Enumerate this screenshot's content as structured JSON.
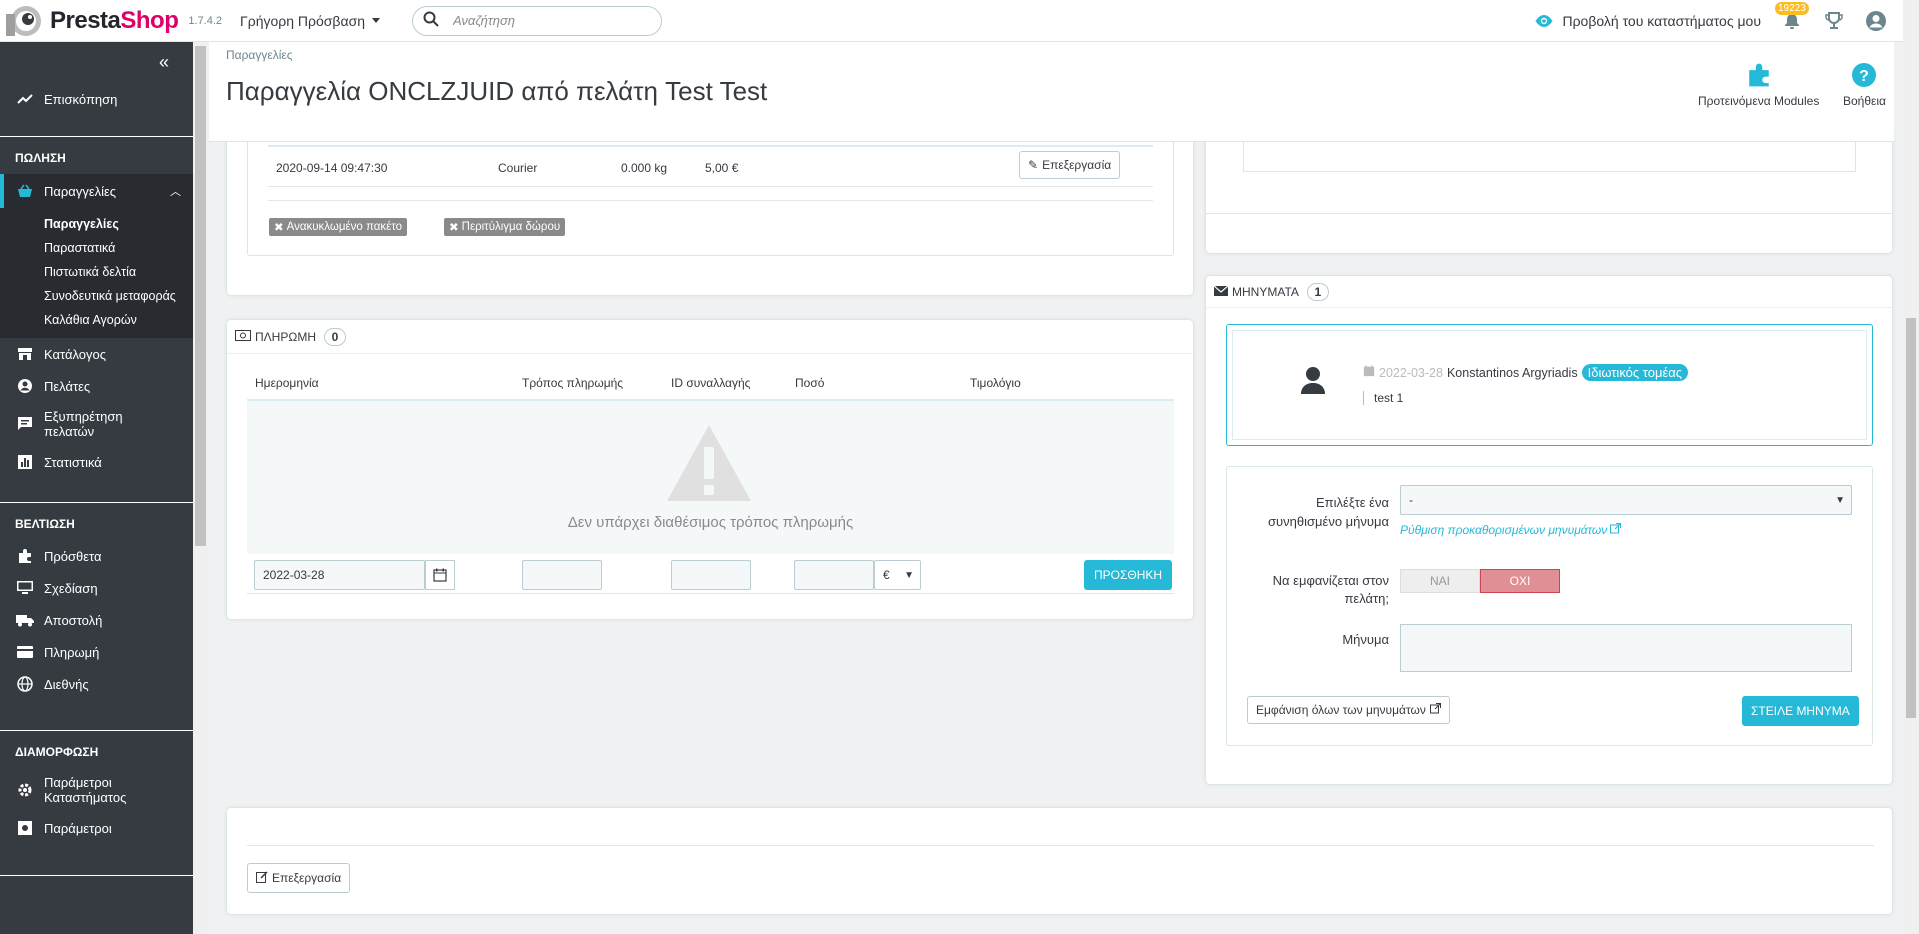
{
  "header": {
    "logo_brand_a": "Presta",
    "logo_brand_b": "Shop",
    "version": "1.7.4.2",
    "quick_access": "Γρήγορη Πρόσβαση",
    "search_placeholder": "Αναζήτηση",
    "view_store": "Προβολή του καταστήματος μου",
    "notifications_count": "19223"
  },
  "sidebar": {
    "overview": "Επισκόπηση",
    "section_sell": "ΠΩΛΗΣΗ",
    "orders": "Παραγγελίες",
    "orders_sub": [
      "Παραγγελίες",
      "Παραστατικά",
      "Πιστωτικά δελτία",
      "Συνοδευτικά μεταφοράς",
      "Καλάθια Αγορών"
    ],
    "catalog": "Κατάλογος",
    "customers": "Πελάτες",
    "customer_service_1": "Εξυπηρέτηση",
    "customer_service_2": "πελατών",
    "stats": "Στατιστικά",
    "section_improve": "ΒΕΛΤΙΩΣΗ",
    "modules": "Πρόσθετα",
    "design": "Σχεδίαση",
    "shipping": "Αποστολή",
    "payment": "Πληρωμή",
    "international": "Διεθνής",
    "section_configure": "ΔΙΑΜΟΡΦΩΣΗ",
    "shop_params_1": "Παράμετροι",
    "shop_params_2": "Καταστήματος",
    "advanced_params": "Παράμετροι"
  },
  "page": {
    "breadcrumb": "Παραγγελίες",
    "title": "Παραγγελία ONCLZJUID από πελάτη Test Test",
    "btn_modules": "Προτεινόμενα Modules",
    "btn_help": "Βοήθεια"
  },
  "shipping": {
    "row": {
      "date": "2020-09-14 09:47:30",
      "carrier": "Courier",
      "weight": "0.000 kg",
      "cost": "5,00 €",
      "edit": "Επεξεργασία"
    },
    "tag_recycled": "Ανακυκλωμένο πακέτο",
    "tag_gift": "Περιτύλιγμα δώρου"
  },
  "payment": {
    "heading": "ΠΛΗΡΩΜΗ",
    "count": "0",
    "cols": [
      "Ημερομηνία",
      "Τρόπος πληρωμής",
      "ID συναλλαγής",
      "Ποσό",
      "Τιμολόγιο"
    ],
    "empty": "Δεν υπάρχει διαθέσιμος τρόπος πληρωμής",
    "date_value": "2022-03-28",
    "currency": "€",
    "add": "ΠΡΟΣΘΗΚΗ"
  },
  "messages": {
    "heading": "ΜΗΝΥΜΑΤΑ",
    "count": "1",
    "msg_date": "2022-03-28",
    "msg_author": "Konstantinos Argyriadis",
    "msg_type": "Ιδιωτικός τομέας",
    "msg_text": "test 1",
    "label_predefined_1": "Επιλέξτε ένα",
    "label_predefined_2": "συνηθισμένο μήνυμα",
    "predefined_value": "-",
    "configure_link": "Ρύθμιση προκαθορισμένων μηνυμάτων",
    "label_display_1": "Να εμφανίζεται στον",
    "label_display_2": "πελάτη;",
    "yes": "ΝΑΙ",
    "no": "ΟΧΙ",
    "label_message": "Μήνυμα",
    "show_all": "Εμφάνιση όλων των μηνυμάτων",
    "send": "ΣΤΕΙΛΕ ΜΗΝΥΜΑ"
  },
  "bottom": {
    "edit": "Επεξεργασία"
  },
  "colors": {
    "accent": "#25b9d7",
    "sidebar": "#363a41",
    "no_toggle": "#e08f95",
    "brand_pink": "#df0067"
  }
}
